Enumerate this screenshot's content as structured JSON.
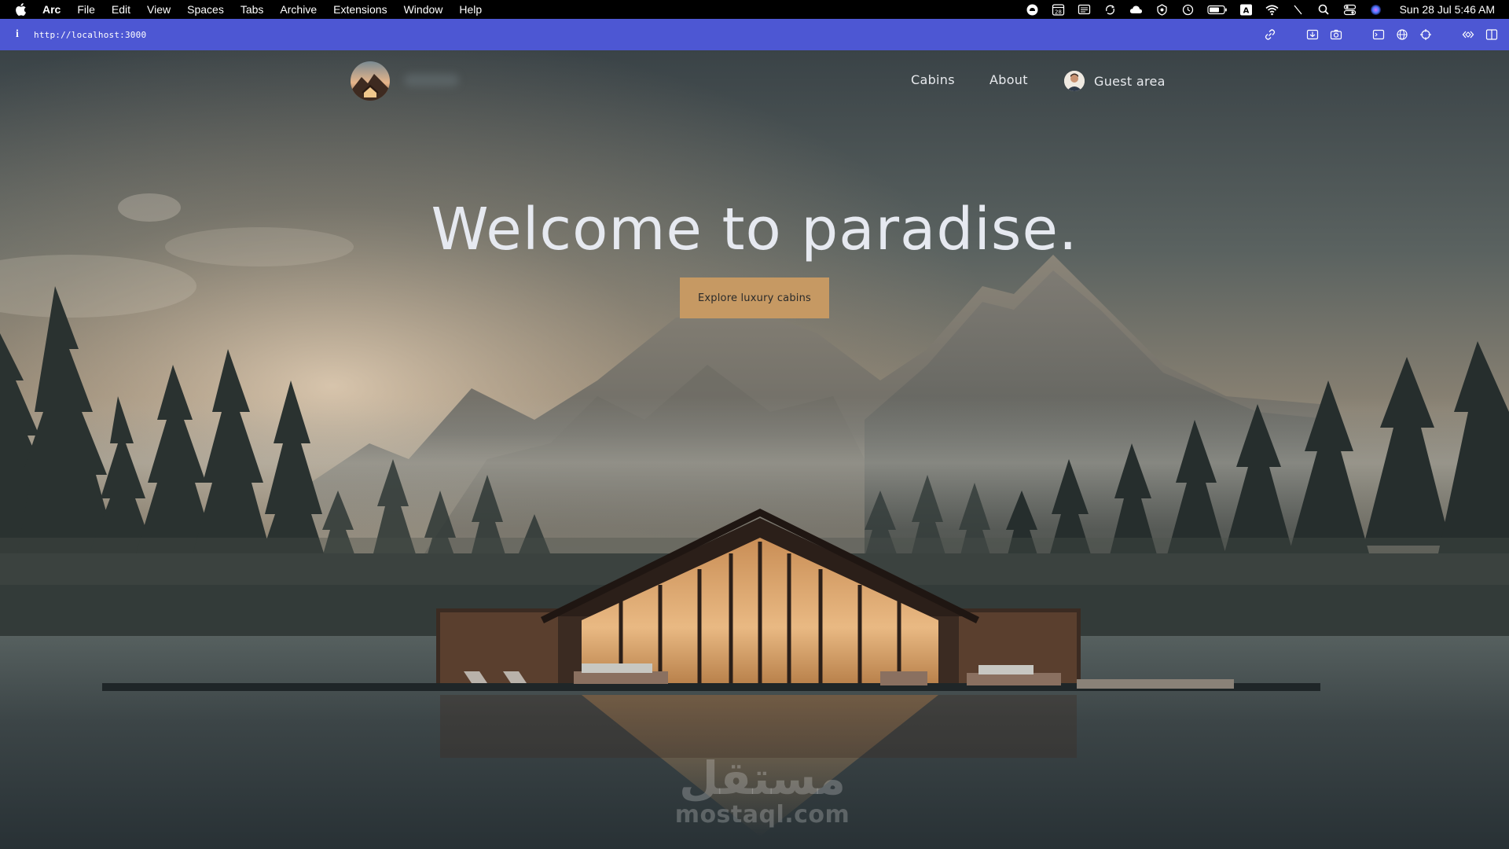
{
  "menubar": {
    "app_name": "Arc",
    "items": [
      "File",
      "Edit",
      "View",
      "Spaces",
      "Tabs",
      "Archive",
      "Extensions",
      "Window",
      "Help"
    ],
    "status_icons": [
      "creative-cloud-icon",
      "calendar-icon",
      "notes-icon",
      "sync-icon",
      "cloud-app-icon",
      "vpn-icon",
      "time-machine-icon",
      "battery-icon",
      "keyboard-input-icon",
      "wifi-icon",
      "slash-icon",
      "spotlight-search-icon",
      "control-center-icon",
      "siri-icon"
    ],
    "calendar_day": "28",
    "input_source": "A",
    "clock": "Sun 28 Jul  5:46 AM"
  },
  "urlbar": {
    "info_glyph": "i",
    "url": "http://localhost:3000",
    "tools": [
      "link-icon",
      "screenshot-icon",
      "camera-icon",
      "sidebar-panel-icon",
      "globe-icon",
      "crosshair-icon",
      "code-icon",
      "split-view-icon"
    ]
  },
  "nav": {
    "links": [
      "Cabins",
      "About"
    ],
    "guest_label": "Guest area"
  },
  "hero": {
    "title": "Welcome to paradise.",
    "cta_label": "Explore luxury cabins"
  },
  "watermark": {
    "arabic": "مستقل",
    "latin": "mostaql.com"
  },
  "colors": {
    "menubar_bg": "#000000",
    "urlbar_bg": "#4d57d3",
    "cta_bg": "#c69963",
    "title_color": "#e6e9f0"
  }
}
